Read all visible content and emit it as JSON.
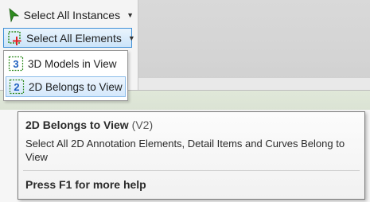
{
  "ribbon": {
    "select_instances": {
      "label": "Select All Instances",
      "icon": "green-cursor-arrow-icon"
    },
    "select_elements": {
      "label": "Select All Elements",
      "icon": "dashed-selection-plus-icon"
    }
  },
  "dropdown": {
    "items": [
      {
        "label": "3D Models in View",
        "icon": "3d-model-icon"
      },
      {
        "label": "2D Belongs to View",
        "icon": "2d-annotation-icon"
      }
    ]
  },
  "tooltip": {
    "title": "2D Belongs to View",
    "version": "(V2)",
    "description": "Select All 2D Annotation Elements, Detail Items and Curves Belong to View",
    "help": "Press F1 for more help"
  },
  "colors": {
    "highlight_border": "#3f8fd6",
    "icon_green": "#2e8b1f",
    "icon_red": "#e02020",
    "icon_blue": "#1f5fbf"
  }
}
